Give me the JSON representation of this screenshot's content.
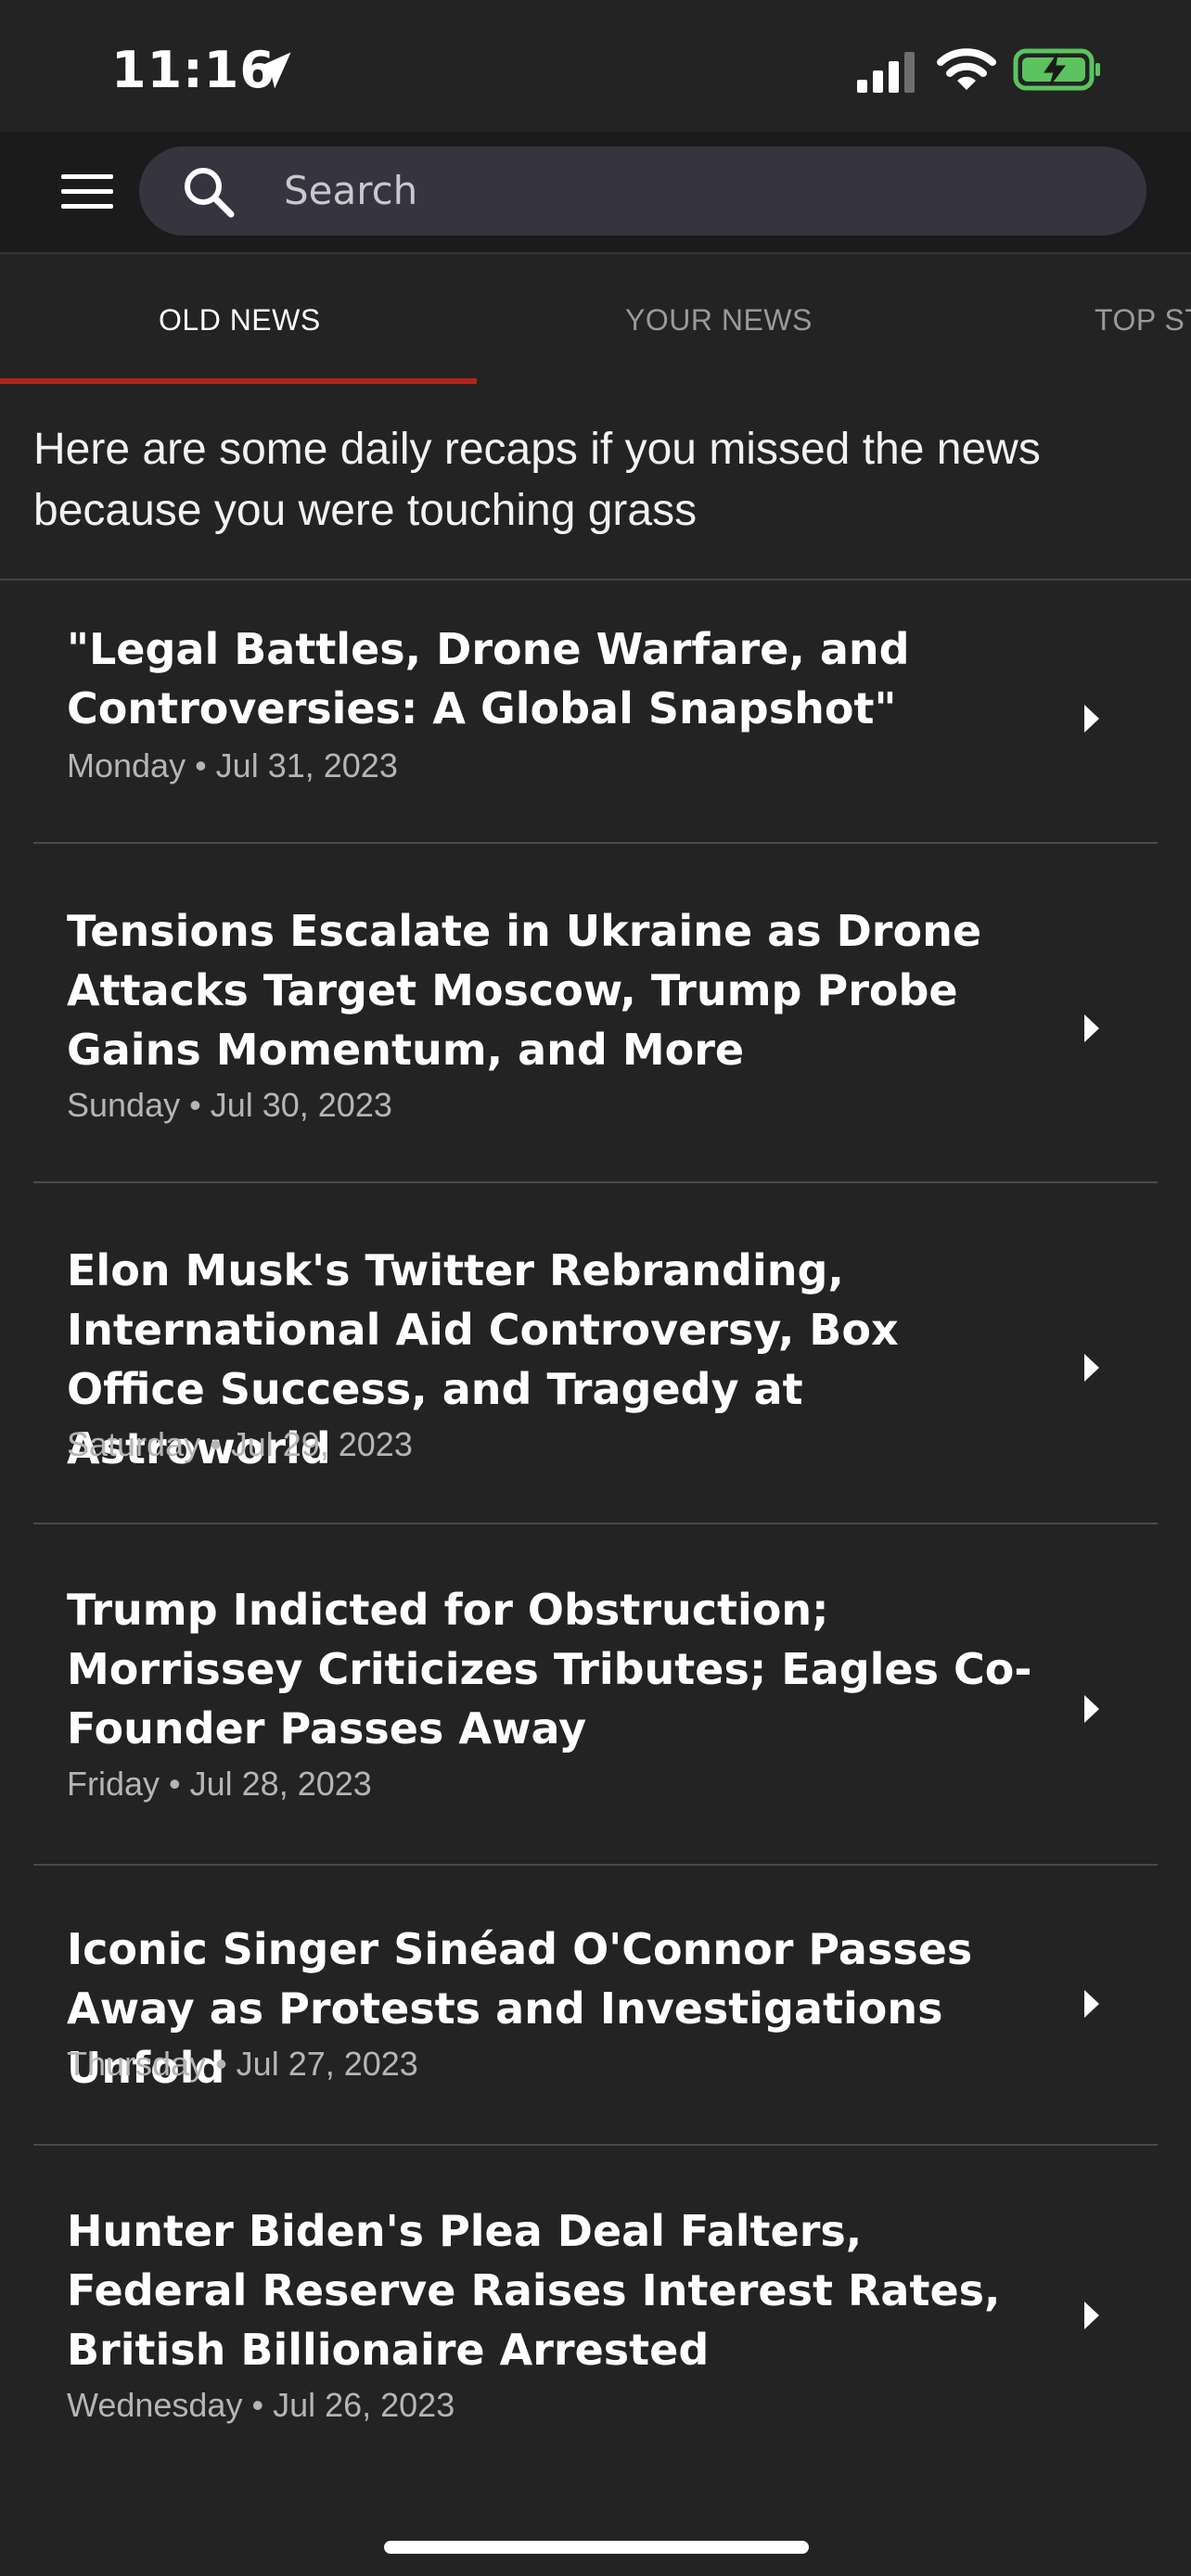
{
  "status_bar": {
    "time": "11:16",
    "icons": [
      "location-arrow-icon",
      "cellular-signal-icon",
      "wifi-icon",
      "battery-charging-icon"
    ],
    "battery_color": "#5cc35f"
  },
  "search": {
    "placeholder": "Search",
    "icons": [
      "hamburger-menu-icon",
      "search-icon"
    ]
  },
  "tabs": [
    {
      "label": "OLD NEWS",
      "active": true
    },
    {
      "label": "YOUR NEWS",
      "active": false
    },
    {
      "label": "TOP ST",
      "active": false
    }
  ],
  "intro": "Here are some daily recaps if you missed the news because you were touching grass",
  "recaps": [
    {
      "title": "\"Legal Battles, Drone Warfare, and Controversies: A Global Snapshot\"",
      "date": "Monday • Jul 31, 2023"
    },
    {
      "title": "Tensions Escalate in Ukraine as Drone Attacks Target Moscow, Trump Probe Gains Momentum, and More",
      "date": "Sunday • Jul 30, 2023"
    },
    {
      "title": "Elon Musk's Twitter Rebranding, International Aid Controversy, Box Office Success, and Tragedy at Astroworld",
      "date": "Saturday • Jul 29, 2023"
    },
    {
      "title": "Trump Indicted for Obstruction; Morrissey Criticizes Tributes; Eagles Co-Founder Passes Away",
      "date": "Friday • Jul 28, 2023"
    },
    {
      "title": "Iconic Singer Sinéad O'Connor Passes Away as Protests and Investigations Unfold",
      "date": "Thursday • Jul 27, 2023"
    },
    {
      "title": "Hunter Biden's Plea Deal Falters, Federal Reserve Raises Interest Rates, British Billionaire Arrested",
      "date": "Wednesday • Jul 26, 2023"
    }
  ],
  "colors": {
    "background": "#232323",
    "accent": "#b3241b",
    "search_field": "#36343f"
  }
}
